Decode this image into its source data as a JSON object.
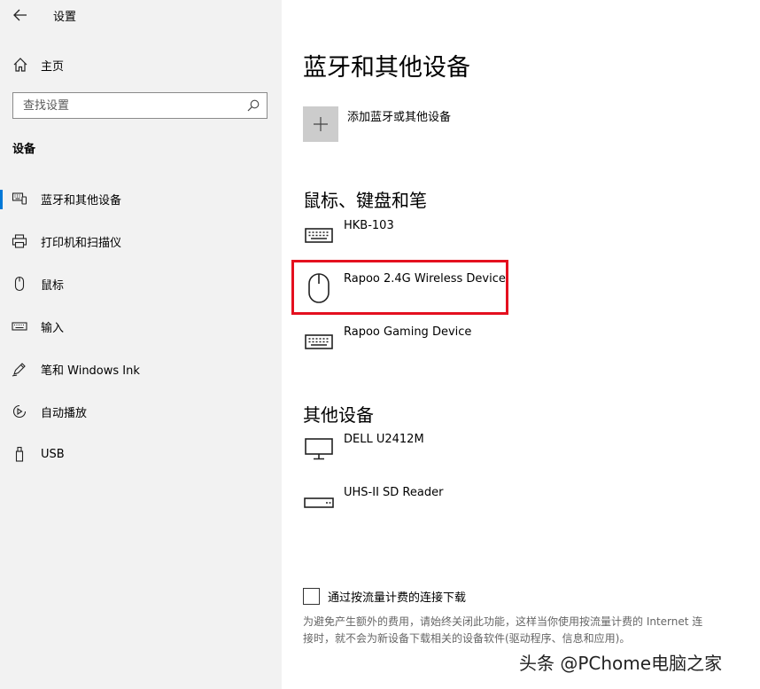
{
  "window": {
    "title": "设置"
  },
  "sidebar": {
    "home_label": "主页",
    "search_placeholder": "查找设置",
    "section_label": "设备",
    "items": [
      {
        "label": "蓝牙和其他设备",
        "icon": "bluetooth-devices-icon",
        "selected": true
      },
      {
        "label": "打印机和扫描仪",
        "icon": "printer-icon",
        "selected": false
      },
      {
        "label": "鼠标",
        "icon": "mouse-icon",
        "selected": false
      },
      {
        "label": "输入",
        "icon": "keyboard-icon",
        "selected": false
      },
      {
        "label": "笔和 Windows Ink",
        "icon": "pen-icon",
        "selected": false
      },
      {
        "label": "自动播放",
        "icon": "autoplay-icon",
        "selected": false
      },
      {
        "label": "USB",
        "icon": "usb-icon",
        "selected": false
      }
    ]
  },
  "main": {
    "title": "蓝牙和其他设备",
    "add_label": "添加蓝牙或其他设备",
    "groups": [
      {
        "heading": "鼠标、键盘和笔",
        "devices": [
          {
            "name": "HKB-103",
            "icon": "keyboard-icon"
          },
          {
            "name": "Rapoo 2.4G Wireless Device",
            "icon": "mouse-icon",
            "highlighted": true
          },
          {
            "name": "Rapoo Gaming Device",
            "icon": "keyboard-icon"
          }
        ]
      },
      {
        "heading": "其他设备",
        "devices": [
          {
            "name": "DELL U2412M",
            "icon": "monitor-icon"
          },
          {
            "name": "UHS-II SD Reader",
            "icon": "drive-icon"
          }
        ]
      }
    ],
    "metered_checkbox_label": "通过按流量计费的连接下载",
    "metered_checked": false,
    "metered_description": "为避免产生额外的费用，请始终关闭此功能，这样当你使用按流量计费的 Internet 连接时，就不会为新设备下载相关的设备软件(驱动程序、信息和应用)。"
  },
  "watermark": "头条 @PChome电脑之家",
  "colors": {
    "accent": "#0078d7",
    "highlight": "#e4101f",
    "sidebar_bg": "#f2f2f2"
  }
}
